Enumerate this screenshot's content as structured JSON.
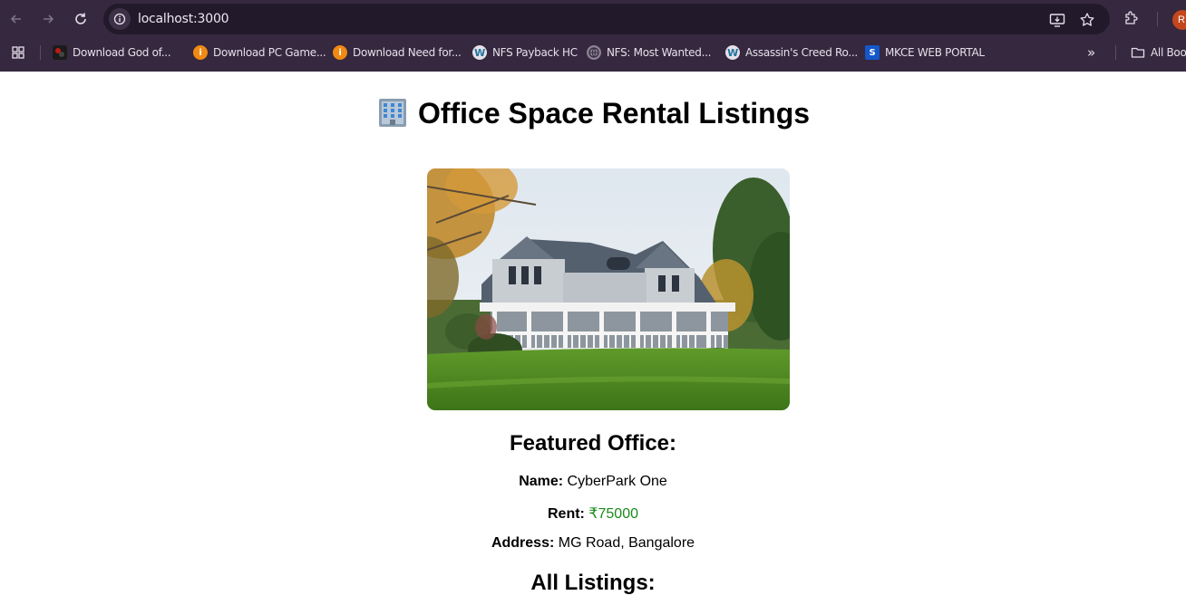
{
  "browser": {
    "url": "localhost:3000",
    "bookmarks": [
      {
        "label": "Download God of...",
        "icon": "god-of-war-icon"
      },
      {
        "label": "Download PC Game...",
        "icon": "orange-info-icon"
      },
      {
        "label": "Download Need for...",
        "icon": "orange-info-icon"
      },
      {
        "label": "NFS Payback HC",
        "icon": "wordpress-icon"
      },
      {
        "label": "NFS: Most Wanted...",
        "icon": "globe-icon"
      },
      {
        "label": "Assassin's Creed Ro...",
        "icon": "wordpress-icon"
      },
      {
        "label": "MKCE WEB PORTAL",
        "icon": "s-logo-icon"
      }
    ],
    "all_bookmarks_label": "All Boo",
    "avatar_letter": "R"
  },
  "page": {
    "title": "Office Space Rental Listings",
    "title_icon": "office-building-icon",
    "featured_heading": "Featured Office:",
    "name_label": "Name:",
    "name_value": "CyberPark One",
    "rent_label": "Rent:",
    "rent_value": "₹75000",
    "address_label": "Address:",
    "address_value": "MG Road, Bangalore",
    "all_heading": "All Listings:"
  },
  "colors": {
    "chrome": "#35283f",
    "omnibox": "#221a2b",
    "rent_green": "#1a8a1a",
    "avatar": "#c4461d"
  }
}
